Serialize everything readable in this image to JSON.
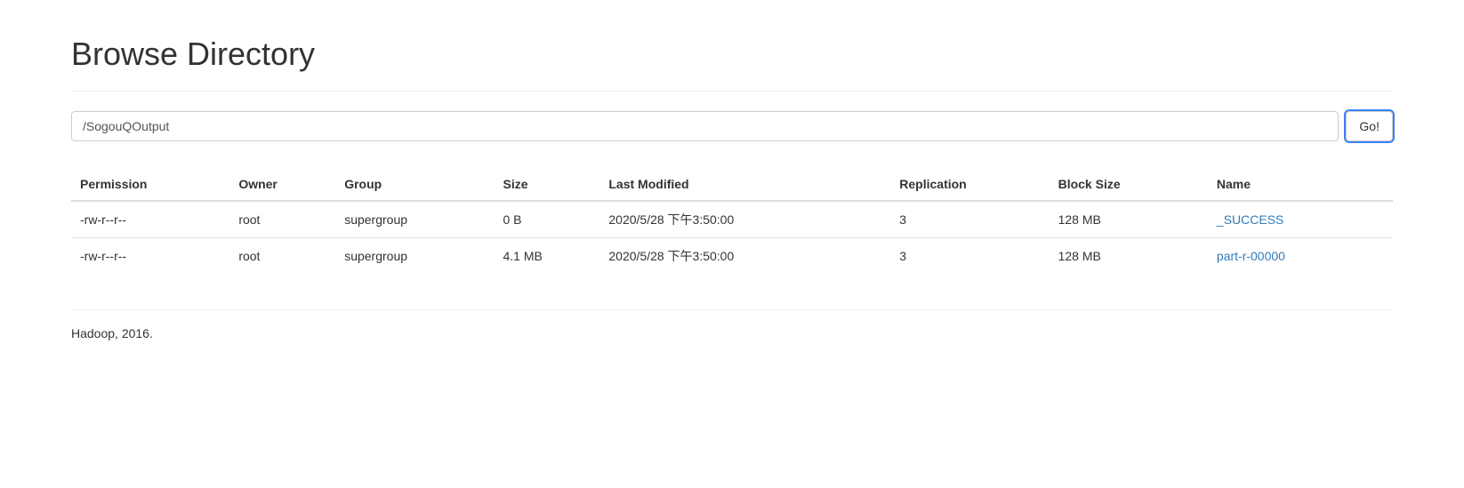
{
  "title": "Browse Directory",
  "path_value": "/SogouQOutput",
  "go_label": "Go!",
  "columns": {
    "permission": "Permission",
    "owner": "Owner",
    "group": "Group",
    "size": "Size",
    "last_modified": "Last Modified",
    "replication": "Replication",
    "block_size": "Block Size",
    "name": "Name"
  },
  "rows": [
    {
      "permission": "-rw-r--r--",
      "owner": "root",
      "group": "supergroup",
      "size": "0 B",
      "last_modified": "2020/5/28 下午3:50:00",
      "replication": "3",
      "block_size": "128 MB",
      "name": "_SUCCESS"
    },
    {
      "permission": "-rw-r--r--",
      "owner": "root",
      "group": "supergroup",
      "size": "4.1 MB",
      "last_modified": "2020/5/28 下午3:50:00",
      "replication": "3",
      "block_size": "128 MB",
      "name": "part-r-00000"
    }
  ],
  "footer": "Hadoop, 2016."
}
